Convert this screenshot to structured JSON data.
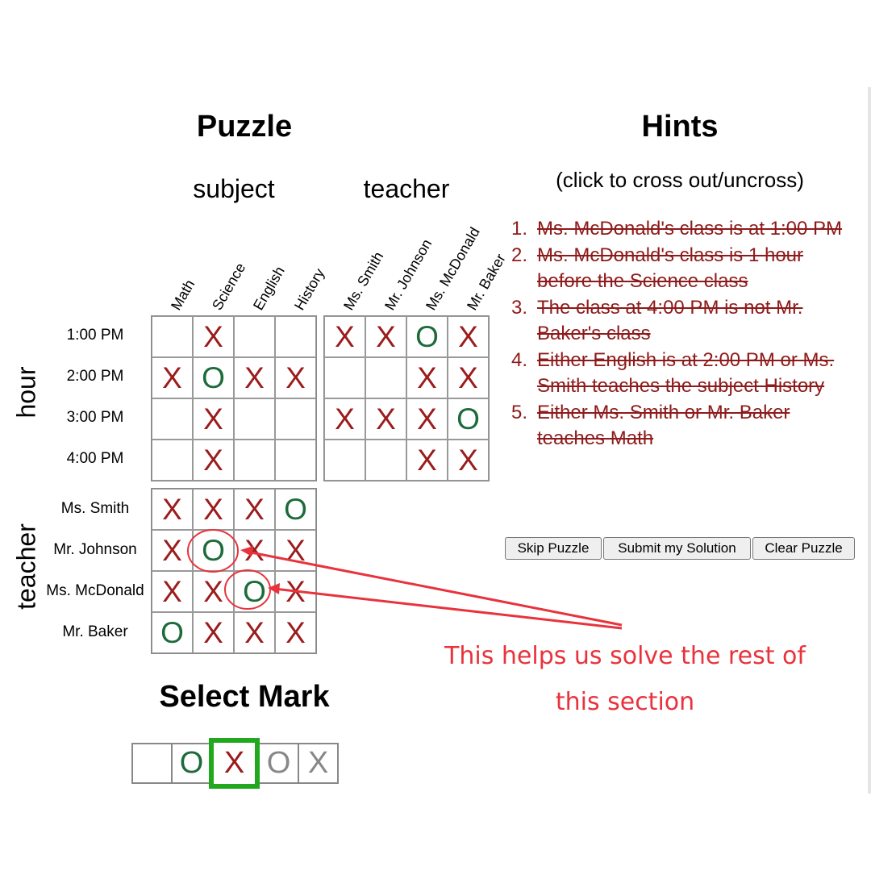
{
  "puzzle_title": "Puzzle",
  "hints_title": "Hints",
  "hints_subtitle": "(click to cross out/uncross)",
  "group_subject": "subject",
  "group_teacher_top": "teacher",
  "side_hour": "hour",
  "side_teacher": "teacher",
  "subjects": [
    "Math",
    "Science",
    "English",
    "History"
  ],
  "teachers": [
    "Ms. Smith",
    "Mr. Johnson",
    "Ms. McDonald",
    "Mr. Baker"
  ],
  "hours": [
    "1:00 PM",
    "2:00 PM",
    "3:00 PM",
    "4:00 PM"
  ],
  "grid_hour_subject": [
    [
      "",
      "X",
      "",
      ""
    ],
    [
      "X",
      "O",
      "X",
      "X"
    ],
    [
      "",
      "X",
      "",
      ""
    ],
    [
      "",
      "X",
      "",
      ""
    ]
  ],
  "grid_hour_teacher": [
    [
      "X",
      "X",
      "O",
      "X"
    ],
    [
      "",
      "",
      "X",
      "X"
    ],
    [
      "X",
      "X",
      "X",
      "O"
    ],
    [
      "",
      "",
      "X",
      "X"
    ]
  ],
  "grid_teacher_subject": [
    [
      "X",
      "X",
      "X",
      "O"
    ],
    [
      "X",
      "O",
      "X",
      "X"
    ],
    [
      "X",
      "X",
      "O",
      "X"
    ],
    [
      "O",
      "X",
      "X",
      "X"
    ]
  ],
  "hints": [
    {
      "num": "1.",
      "text": "Ms. McDonald's class is at 1:00 PM",
      "crossed": true
    },
    {
      "num": "2.",
      "text": "Ms. McDonald's class is 1 hour before the Science class",
      "crossed": true
    },
    {
      "num": "3.",
      "text": "The class at 4:00 PM is not Mr. Baker's class",
      "crossed": true
    },
    {
      "num": "4.",
      "text": "Either English is at 2:00 PM or Ms. Smith teaches the subject History",
      "crossed": true
    },
    {
      "num": "5.",
      "text": "Either Ms. Smith or Mr. Baker teaches Math",
      "crossed": true
    }
  ],
  "buttons": {
    "skip": "Skip Puzzle",
    "submit": "Submit my Solution",
    "clear": "Clear Puzzle"
  },
  "select_mark_title": "Select Mark",
  "select_marks": [
    "",
    "O",
    "X",
    "O",
    "X"
  ],
  "selected_mark_index": 2,
  "annotation": {
    "line1": "This helps us solve the rest of",
    "line2": "this section"
  },
  "colors": {
    "x_mark": "#9b1c1c",
    "o_mark": "#1d6b3a",
    "annotation": "#e8333c",
    "selected_border": "#22a81f"
  }
}
